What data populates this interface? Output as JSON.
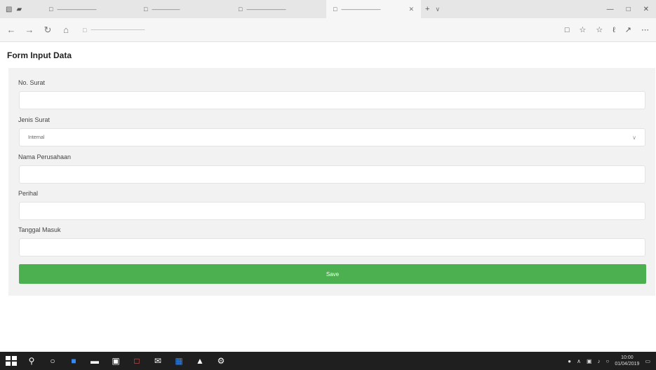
{
  "browser": {
    "tabs": [
      {
        "label": "———————",
        "active": false
      },
      {
        "label": "—————",
        "active": false
      },
      {
        "label": "———————",
        "active": false
      },
      {
        "label": "———————",
        "active": true
      }
    ],
    "address": "———————————"
  },
  "page": {
    "title": "Form Input Data"
  },
  "form": {
    "fields": [
      {
        "label": "No. Surat",
        "value": ""
      },
      {
        "label": "Jenis Surat",
        "value": "Internal"
      },
      {
        "label": "Nama Perusahaan",
        "value": ""
      },
      {
        "label": "Perihal",
        "value": ""
      },
      {
        "label": "Tanggal Masuk",
        "value": ""
      }
    ],
    "save_label": "Save"
  },
  "taskbar": {
    "time": "10:00",
    "date": "01/04/2019"
  },
  "colors": {
    "accent": "#4caf50",
    "form_bg": "#f2f2f2",
    "taskbar_bg": "#1f1f1f"
  }
}
